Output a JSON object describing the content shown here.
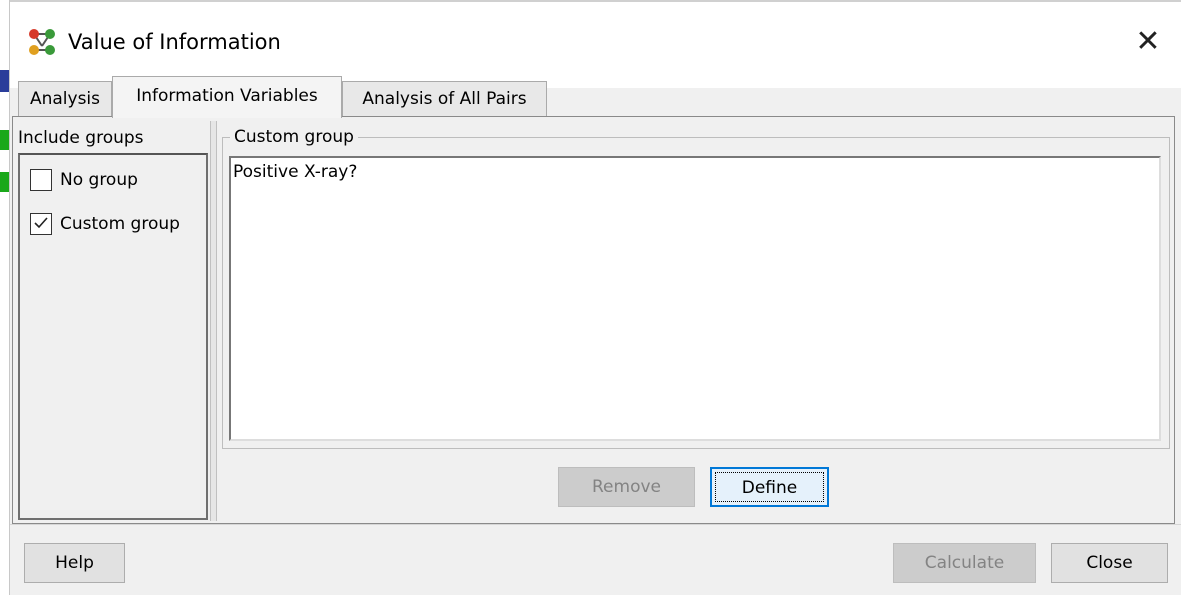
{
  "window": {
    "title": "Value of Information",
    "app_icon": "network-nodes-icon",
    "close_glyph": "✕"
  },
  "tabs": [
    {
      "label": "Analysis",
      "active": false
    },
    {
      "label": "Information Variables",
      "active": true
    },
    {
      "label": "Analysis of All Pairs",
      "active": false
    }
  ],
  "include_groups": {
    "header": "Include groups",
    "items": [
      {
        "label": "No group",
        "checked": false
      },
      {
        "label": "Custom group",
        "checked": true
      }
    ]
  },
  "custom_group": {
    "legend": "Custom group",
    "items": [
      "Positive X-ray?"
    ],
    "remove_label": "Remove",
    "remove_enabled": false,
    "define_label": "Define"
  },
  "footer": {
    "help_label": "Help",
    "calculate_label": "Calculate",
    "calculate_enabled": false,
    "close_label": "Close"
  },
  "colors": {
    "accent": "#0078d7",
    "background": "#f0f0f0",
    "disabled_text": "#838383"
  }
}
